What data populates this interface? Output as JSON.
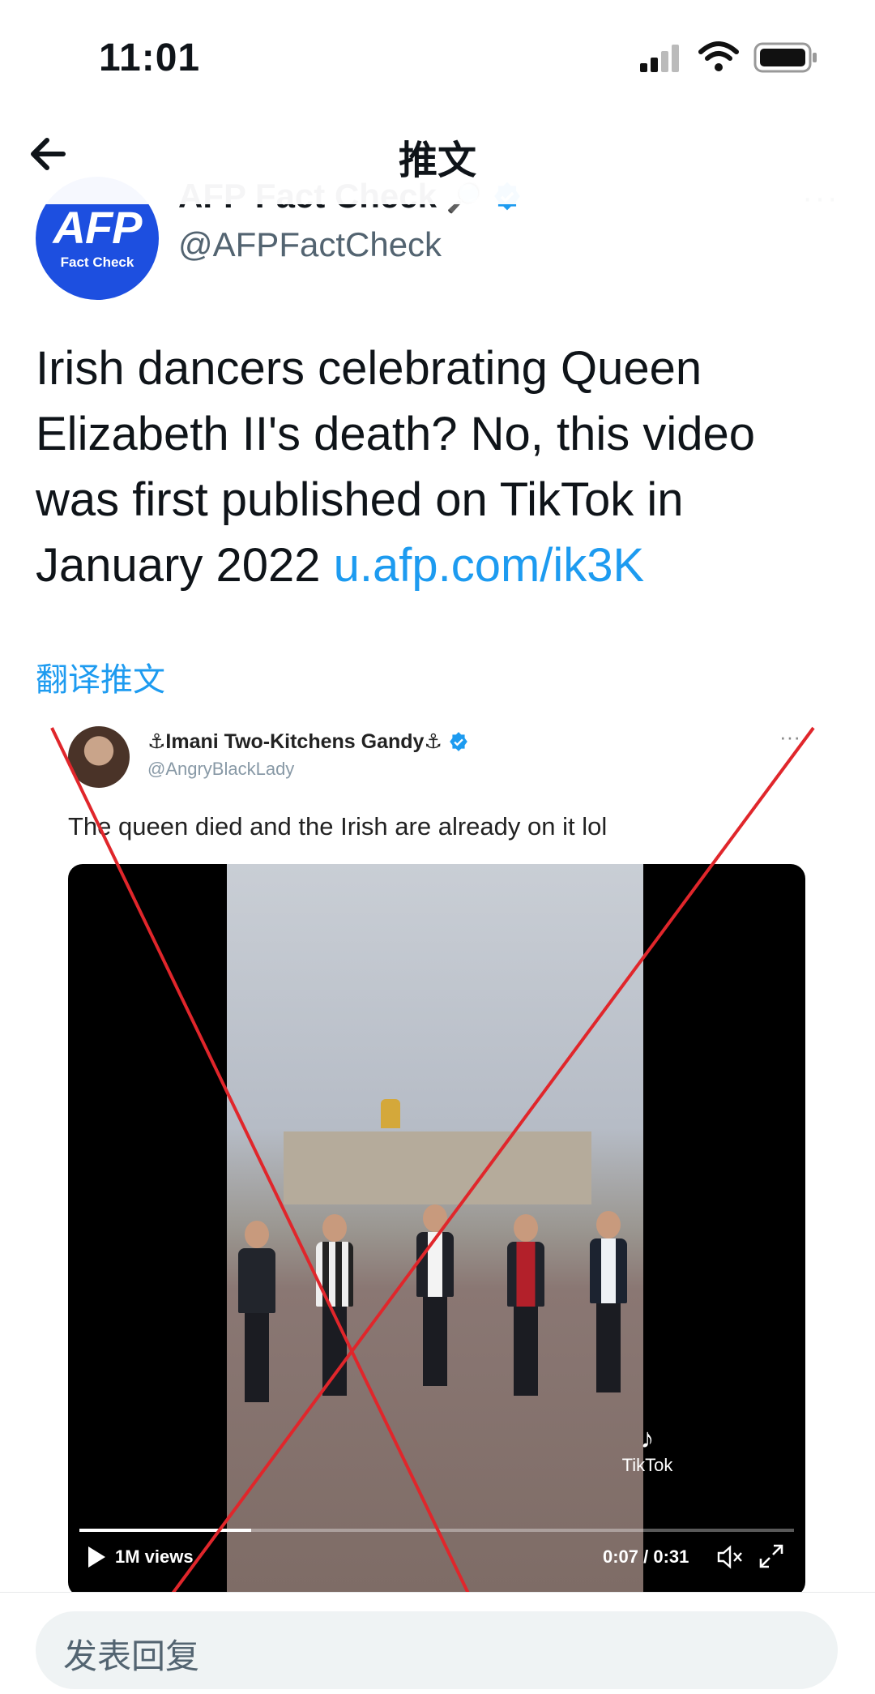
{
  "status_bar": {
    "time": "11:01"
  },
  "header": {
    "title": "推文"
  },
  "author": {
    "avatar_main": "AFP",
    "avatar_sub": "Fact Check",
    "name": "AFP Fact Check",
    "handle": "@AFPFactCheck"
  },
  "tweet": {
    "text": "Irish dancers celebrating Queen Elizabeth II's death? No, this video was first published on TikTok in January 2022 ",
    "link": "u.afp.com/ik3K",
    "translate": "翻译推文"
  },
  "embedded": {
    "name": "⚓Imani Two-Kitchens Gandy⚓",
    "handle": "@AngryBlackLady",
    "text": "The queen died and the Irish are already on it lol",
    "tiktok_label": "TikTok",
    "views": "1M views",
    "time": "0:07 / 0:31",
    "progress": 0.24
  },
  "reply": {
    "placeholder": "发表回复"
  },
  "colors": {
    "link": "#1d9bf0",
    "avatar": "#1d4fe0",
    "cross": "#e0262b"
  }
}
